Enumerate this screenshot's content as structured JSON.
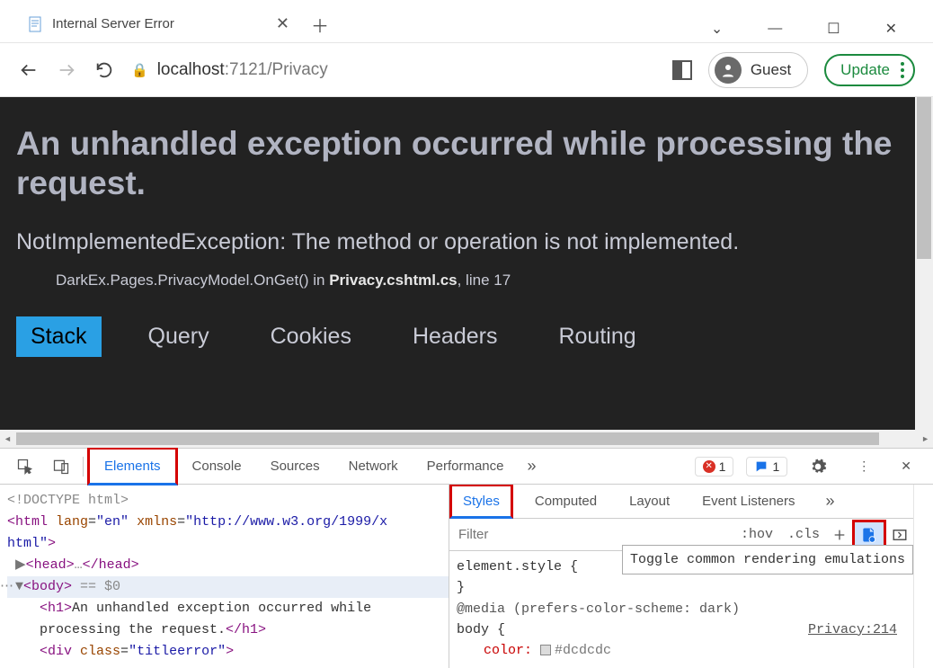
{
  "window": {
    "tab_title": "Internal Server Error"
  },
  "addressbar": {
    "host": "localhost",
    "port_path": ":7121/Privacy",
    "guest_label": "Guest",
    "update_label": "Update"
  },
  "error_page": {
    "heading": "An unhandled exception occurred while processing the request.",
    "exception": "NotImplementedException: The method or operation is not implemented.",
    "stack_prefix": "DarkEx.Pages.PrivacyModel.OnGet() in ",
    "stack_file": "Privacy.cshtml.cs",
    "stack_suffix": ", line 17",
    "tabs": [
      "Stack",
      "Query",
      "Cookies",
      "Headers",
      "Routing"
    ]
  },
  "devtools": {
    "tabs": [
      "Elements",
      "Console",
      "Sources",
      "Network",
      "Performance"
    ],
    "error_count": "1",
    "message_count": "1",
    "dom": {
      "doctype": "<!DOCTYPE html>",
      "html_open": "<html lang=\"en\" xmlns=\"http://www.w3.org/1999/xhtml\">",
      "head": "<head>…</head>",
      "body_open": "<body>",
      "body_sel": " == $0",
      "h1_open": "<h1>",
      "h1_text": "An unhandled exception occurred while processing the request.",
      "h1_close": "</h1>",
      "div_open": "<div class=\"titleerror\">"
    },
    "styles": {
      "tabs": [
        "Styles",
        "Computed",
        "Layout",
        "Event Listeners"
      ],
      "filter_placeholder": "Filter",
      "hov": ":hov",
      "cls": ".cls",
      "tooltip": "Toggle common rendering emulations",
      "element_style": "element.style {",
      "close_brace": "}",
      "media": "@media (prefers-color-scheme: dark)",
      "body_sel": "body {",
      "color_prop": "color:",
      "color_val": "#dcdcdc",
      "source_link": "Privacy:214"
    }
  }
}
